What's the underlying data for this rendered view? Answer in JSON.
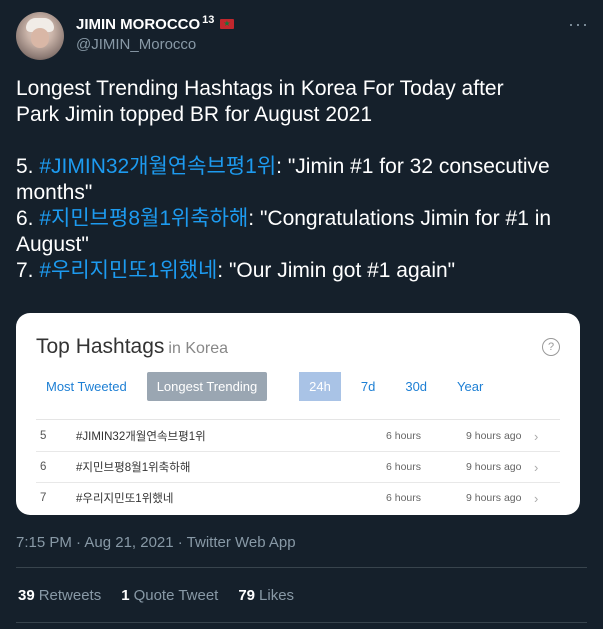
{
  "author": {
    "display_name": "JIMIN MOROCCO",
    "badge": "13",
    "handle": "@JIMIN_Morocco",
    "more_label": "···"
  },
  "tweet": {
    "line1": "Longest Trending Hashtags in Korea For Today after",
    "line2": "Park Jimin topped BR  for August 2021",
    "items": [
      {
        "prefix": "5. ",
        "hashtag": "#JIMIN32개월연속브평1위",
        "rest": ": \"Jimin #1 for 32 consecutive months\""
      },
      {
        "prefix": "6. ",
        "hashtag": "#지민브평8월1위축하해",
        "rest": ": \"Congratulations Jimin for #1 in August\""
      },
      {
        "prefix": "7. ",
        "hashtag": "#우리지민또1위했네",
        "rest": ": \"Our Jimin got #1 again\""
      }
    ]
  },
  "card": {
    "title": "Top Hashtags",
    "title_suffix": "in Korea",
    "help": "?",
    "tabs": {
      "most_tweeted": "Most Tweeted",
      "longest_trending": "Longest Trending",
      "p24h": "24h",
      "p7d": "7d",
      "p30d": "30d",
      "year": "Year"
    },
    "rows": [
      {
        "rank": "5",
        "tag": "#JIMIN32개월연속브평1위",
        "duration": "6 hours",
        "ago": "9 hours ago"
      },
      {
        "rank": "6",
        "tag": "#지민브평8월1위축하해",
        "duration": "6 hours",
        "ago": "9 hours ago"
      },
      {
        "rank": "7",
        "tag": "#우리지민또1위했네",
        "duration": "6 hours",
        "ago": "9 hours ago"
      }
    ]
  },
  "meta": "7:15 PM · Aug 21, 2021 · Twitter Web App",
  "stats": {
    "retweets_count": "39",
    "retweets_label": "Retweets",
    "quotes_count": "1",
    "quotes_label": "Quote Tweet",
    "likes_count": "79",
    "likes_label": "Likes"
  },
  "colors": {
    "background": "#15202b",
    "hashtag": "#1d9bf0",
    "muted": "#8899a6"
  }
}
